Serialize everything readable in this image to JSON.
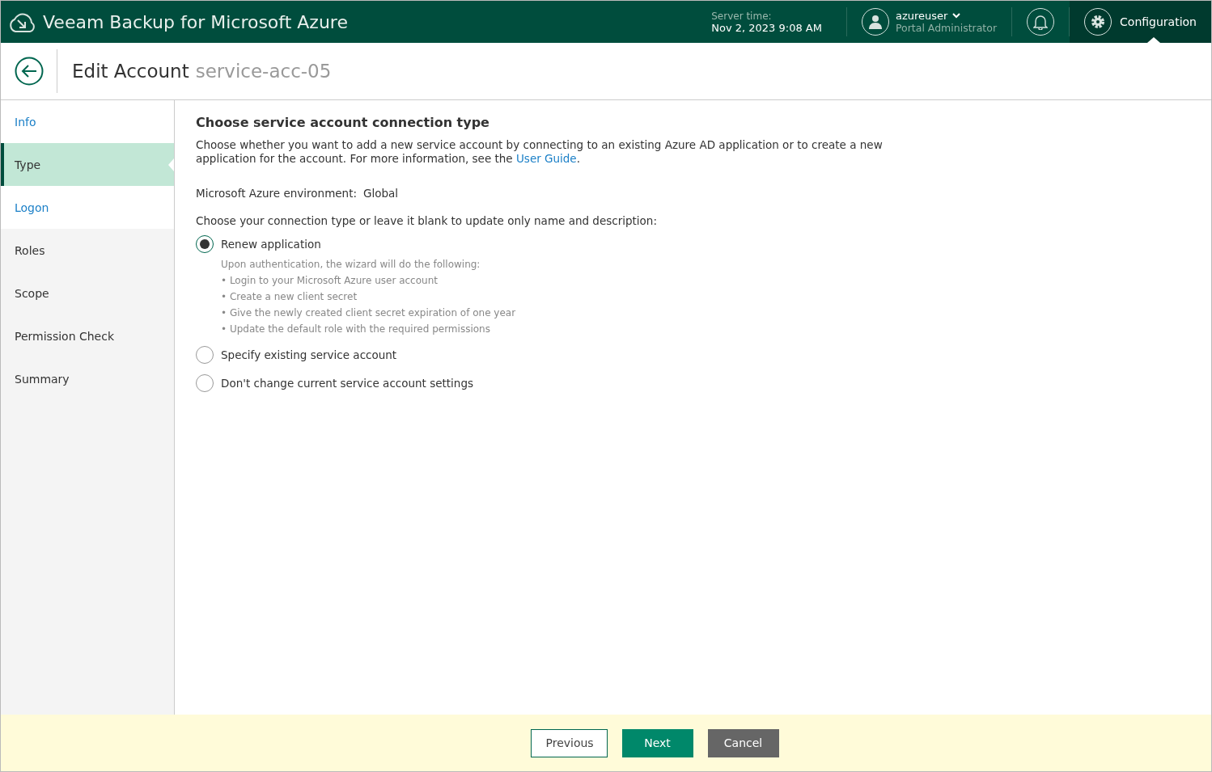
{
  "topbar": {
    "product": "Veeam Backup for Microsoft Azure",
    "server_time_label": "Server time:",
    "server_time": "Nov 2, 2023 9:08 AM",
    "user": {
      "name": "azureuser",
      "role": "Portal Administrator"
    },
    "configuration": {
      "label": "Configuration",
      "selected": true
    }
  },
  "header": {
    "title": "Edit Account",
    "subtitle": "service-acc-05"
  },
  "steps": [
    {
      "label": "Info",
      "selected": false,
      "visited": true
    },
    {
      "label": "Type",
      "selected": true,
      "visited": true
    },
    {
      "label": "Logon",
      "selected": false,
      "visited": true
    },
    {
      "label": "Roles",
      "selected": false,
      "visited": false
    },
    {
      "label": "Scope",
      "selected": false,
      "visited": false
    },
    {
      "label": "Permission Check",
      "selected": false,
      "visited": false
    },
    {
      "label": "Summary",
      "selected": false,
      "visited": false
    }
  ],
  "content": {
    "heading": "Choose service account connection type",
    "description": "Choose whether you want to add a new service account by connecting to an existing Azure AD application or to create a new application for the account. For more information, see the",
    "link": "User Guide",
    "description_end": ".",
    "environment_label": "Microsoft Azure environment:",
    "environment_value": "Global",
    "prompt": "Choose your connection type or leave it blank to update only name and description:",
    "options": [
      {
        "label": "Renew application",
        "selected": true,
        "details": [
          "Upon authentication, the wizard will do the following:",
          "• Login to your Microsoft Azure user account",
          "• Create a new client secret",
          "• Give the newly created client secret expiration of one year",
          "• Update the default role with the required permissions"
        ]
      },
      {
        "label": "Specify existing service account",
        "selected": false
      },
      {
        "label": "Don't change current service account settings",
        "selected": false
      }
    ]
  },
  "footer": {
    "buttons": [
      {
        "label": "Previous",
        "kind": "secondary"
      },
      {
        "label": "Next",
        "kind": "primary"
      },
      {
        "label": "Cancel",
        "kind": "neutral"
      }
    ]
  }
}
